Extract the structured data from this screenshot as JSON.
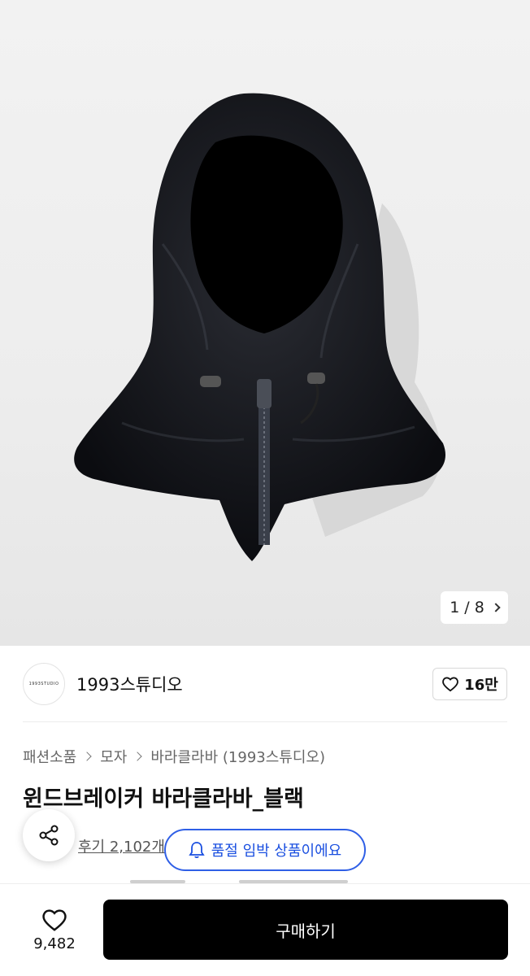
{
  "hero": {
    "image_alt": "black windbreaker balaclava",
    "pager_current": "1",
    "pager_sep": "/",
    "pager_total": "8"
  },
  "brand": {
    "logo_text": "1993STUDIO",
    "name": "1993스튜디오",
    "like_count": "16만"
  },
  "breadcrumb": [
    "패션소품",
    "모자",
    "바라클라바 (1993스튜디오)"
  ],
  "product": {
    "title": "윈드브레이커 바라클라바_블랙",
    "review_text": "후기 2,102개"
  },
  "toast": {
    "text": "품절 임박 상품이에요"
  },
  "bottom": {
    "wish_count": "9,482",
    "buy_label": "구매하기"
  },
  "icons": {
    "heart": "heart-icon",
    "share": "share-icon",
    "bell": "bell-icon",
    "chevron": "chevron-right-icon"
  },
  "colors": {
    "accent_blue": "#2f5fe6",
    "buy_button": "#000000"
  }
}
